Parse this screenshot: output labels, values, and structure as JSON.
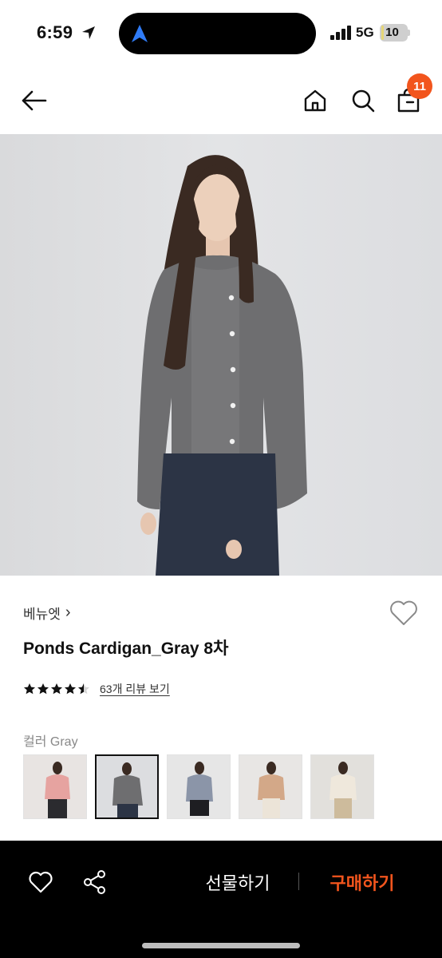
{
  "status_bar": {
    "time": "6:59",
    "network": "5G",
    "battery": "10",
    "battery_fraction": 0.1
  },
  "header": {
    "back_icon": "arrow-left-icon",
    "home_icon": "home-icon",
    "search_icon": "search-icon",
    "cart_icon": "shopping-bag-icon",
    "cart_count": "11",
    "badge_color": "#f2551d"
  },
  "product": {
    "brand": "베뉴엣",
    "brand_chevron": "›",
    "name": "Ponds Cardigan_Gray 8차",
    "rating": 4.5,
    "review_link": "63개 리뷰 보기",
    "color_label": "컬러",
    "selected_color": "Gray",
    "color_options_shown": 5,
    "selected_swatch_index": 1
  },
  "bottom_bar": {
    "gift_label": "선물하기",
    "buy_label": "구매하기",
    "buy_color": "#f2551d",
    "wish_icon": "heart-icon",
    "share_icon": "share-icon"
  }
}
